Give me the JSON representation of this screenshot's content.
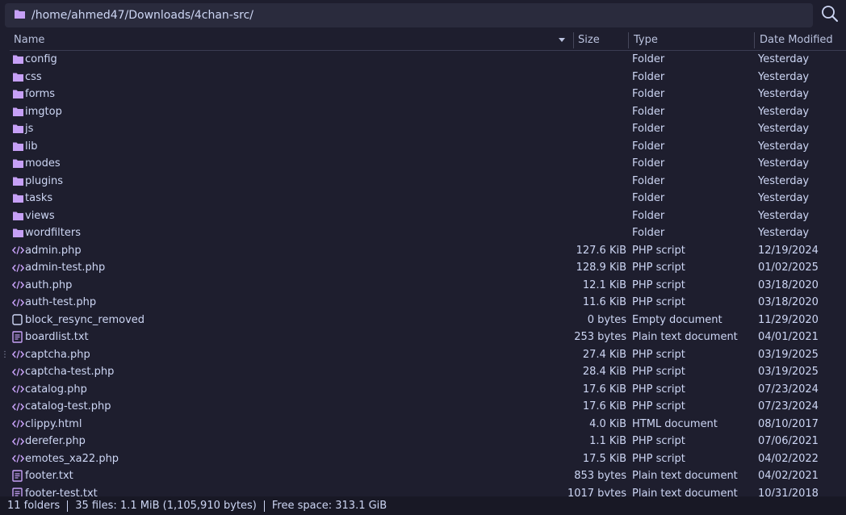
{
  "path_bar": {
    "path": "/home/ahmed47/Downloads/4chan-src/"
  },
  "columns": {
    "name": "Name",
    "size": "Size",
    "type": "Type",
    "date": "Date Modified"
  },
  "colors": {
    "folder": "#c6a0f6",
    "php": "#c6a0f6",
    "text": "#cdd6f4"
  },
  "files": [
    {
      "name": "config",
      "size": "",
      "type": "Folder",
      "date": "Yesterday",
      "icon": "folder-icon"
    },
    {
      "name": "css",
      "size": "",
      "type": "Folder",
      "date": "Yesterday",
      "icon": "folder-icon"
    },
    {
      "name": "forms",
      "size": "",
      "type": "Folder",
      "date": "Yesterday",
      "icon": "folder-icon"
    },
    {
      "name": "imgtop",
      "size": "",
      "type": "Folder",
      "date": "Yesterday",
      "icon": "folder-icon"
    },
    {
      "name": "js",
      "size": "",
      "type": "Folder",
      "date": "Yesterday",
      "icon": "folder-icon"
    },
    {
      "name": "lib",
      "size": "",
      "type": "Folder",
      "date": "Yesterday",
      "icon": "folder-icon"
    },
    {
      "name": "modes",
      "size": "",
      "type": "Folder",
      "date": "Yesterday",
      "icon": "folder-icon"
    },
    {
      "name": "plugins",
      "size": "",
      "type": "Folder",
      "date": "Yesterday",
      "icon": "folder-icon"
    },
    {
      "name": "tasks",
      "size": "",
      "type": "Folder",
      "date": "Yesterday",
      "icon": "folder-icon"
    },
    {
      "name": "views",
      "size": "",
      "type": "Folder",
      "date": "Yesterday",
      "icon": "folder-icon"
    },
    {
      "name": "wordfilters",
      "size": "",
      "type": "Folder",
      "date": "Yesterday",
      "icon": "folder-icon"
    },
    {
      "name": "admin.php",
      "size": "127.6 KiB",
      "type": "PHP script",
      "date": "12/19/2024",
      "icon": "code-file-icon"
    },
    {
      "name": "admin-test.php",
      "size": "128.9 KiB",
      "type": "PHP script",
      "date": "01/02/2025",
      "icon": "code-file-icon"
    },
    {
      "name": "auth.php",
      "size": "12.1 KiB",
      "type": "PHP script",
      "date": "03/18/2020",
      "icon": "code-file-icon"
    },
    {
      "name": "auth-test.php",
      "size": "11.6 KiB",
      "type": "PHP script",
      "date": "03/18/2020",
      "icon": "code-file-icon"
    },
    {
      "name": "block_resync_removed",
      "size": "0 bytes",
      "type": "Empty document",
      "date": "11/29/2020",
      "icon": "empty-file-icon"
    },
    {
      "name": "boardlist.txt",
      "size": "253 bytes",
      "type": "Plain text document",
      "date": "04/01/2021",
      "icon": "text-file-icon"
    },
    {
      "name": "captcha.php",
      "size": "27.4 KiB",
      "type": "PHP script",
      "date": "03/19/2025",
      "icon": "code-file-icon"
    },
    {
      "name": "captcha-test.php",
      "size": "28.4 KiB",
      "type": "PHP script",
      "date": "03/19/2025",
      "icon": "code-file-icon"
    },
    {
      "name": "catalog.php",
      "size": "17.6 KiB",
      "type": "PHP script",
      "date": "07/23/2024",
      "icon": "code-file-icon"
    },
    {
      "name": "catalog-test.php",
      "size": "17.6 KiB",
      "type": "PHP script",
      "date": "07/23/2024",
      "icon": "code-file-icon"
    },
    {
      "name": "clippy.html",
      "size": "4.0 KiB",
      "type": "HTML document",
      "date": "08/10/2017",
      "icon": "code-file-icon"
    },
    {
      "name": "derefer.php",
      "size": "1.1 KiB",
      "type": "PHP script",
      "date": "07/06/2021",
      "icon": "code-file-icon"
    },
    {
      "name": "emotes_xa22.php",
      "size": "17.5 KiB",
      "type": "PHP script",
      "date": "04/02/2022",
      "icon": "code-file-icon"
    },
    {
      "name": "footer.txt",
      "size": "853 bytes",
      "type": "Plain text document",
      "date": "04/02/2021",
      "icon": "text-file-icon"
    },
    {
      "name": "footer-test.txt",
      "size": "1017 bytes",
      "type": "Plain text document",
      "date": "10/31/2018",
      "icon": "text-file-icon"
    }
  ],
  "status": {
    "folders": "11 folders",
    "files": "35 files: 1.1 MiB (1,105,910 bytes)",
    "free": "Free space: 313.1 GiB"
  }
}
